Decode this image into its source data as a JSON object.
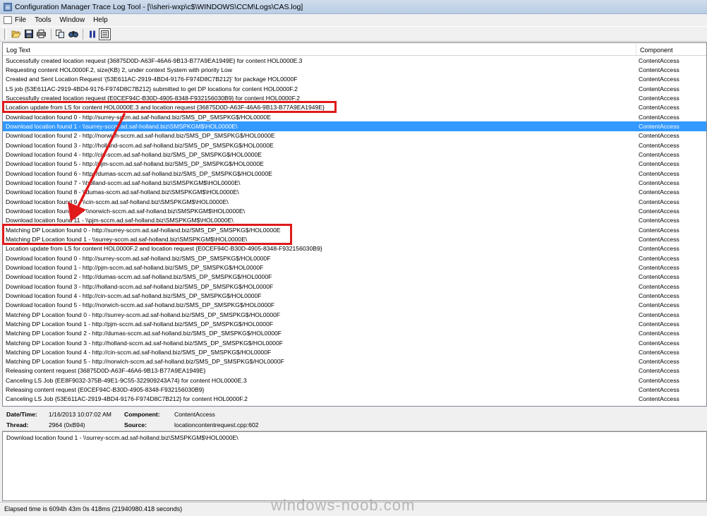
{
  "window": {
    "title": "Configuration Manager Trace Log Tool - [\\\\sheri-wxp\\c$\\WINDOWS\\CCM\\Logs\\CAS.log]"
  },
  "menu": [
    "File",
    "Tools",
    "Window",
    "Help"
  ],
  "toolbar": {
    "icons": [
      "open-icon",
      "save-icon",
      "print-icon",
      "copy-icon",
      "find-icon",
      "pause-icon",
      "highlight-icon"
    ]
  },
  "columns": {
    "log": "Log Text",
    "component": "Component"
  },
  "rows": [
    {
      "text": "Successfully created location request {36875D0D-A63F-46A6-9B13-B77A9EA1949E} for content HOL0000E.3",
      "component": "ContentAccess"
    },
    {
      "text": "Requesting content HOL0000F.2, size(KB) 2, under context System with priority Low",
      "component": "ContentAccess"
    },
    {
      "text": "Created and Sent Location Request '{53E611AC-2919-4BD4-9176-F974D8C7B212}' for package HOL0000F",
      "component": "ContentAccess"
    },
    {
      "text": "LS job {53E611AC-2919-4BD4-9176-F974D8C7B212} submitted to get DP locations for content HOL0000F.2",
      "component": "ContentAccess"
    },
    {
      "text": "Successfully created location request {E0CEF94C-B30D-4905-8348-F932156030B9} for content HOL0000F.2",
      "component": "ContentAccess"
    },
    {
      "text": "Location update from LS for content HOL0000E.3 and location request {36875D0D-A63F-46A6-9B13-B77A9EA1949E}",
      "component": "ContentAccess"
    },
    {
      "text": "Download location found 0 - http://surrey-sccm.ad.saf-holland.biz/SMS_DP_SMSPKG$/HOL0000E",
      "component": "ContentAccess"
    },
    {
      "text": "Download location found 1 - \\\\surrey-sccm.ad.saf-holland.biz\\SMSPKGM$\\HOL0000E\\",
      "component": "ContentAccess"
    },
    {
      "text": "Download location found 2 - http://norwich-sccm.ad.saf-holland.biz/SMS_DP_SMSPKG$/HOL0000E",
      "component": "ContentAccess"
    },
    {
      "text": "Download location found 3 - http://holland-sccm.ad.saf-holland.biz/SMS_DP_SMSPKG$/HOL0000E",
      "component": "ContentAccess"
    },
    {
      "text": "Download location found 4 - http://cin-sccm.ad.saf-holland.biz/SMS_DP_SMSPKG$/HOL0000E",
      "component": "ContentAccess"
    },
    {
      "text": "Download location found 5 - http://pjm-sccm.ad.saf-holland.biz/SMS_DP_SMSPKG$/HOL0000E",
      "component": "ContentAccess"
    },
    {
      "text": "Download location found 6 - http://dumas-sccm.ad.saf-holland.biz/SMS_DP_SMSPKG$/HOL0000E",
      "component": "ContentAccess"
    },
    {
      "text": "Download location found 7 - \\\\holland-sccm.ad.saf-holland.biz\\SMSPKGM$\\HOL0000E\\",
      "component": "ContentAccess"
    },
    {
      "text": "Download location found 8 - \\\\dumas-sccm.ad.saf-holland.biz\\SMSPKGM$\\HOL0000E\\",
      "component": "ContentAccess"
    },
    {
      "text": "Download location found 9 - \\\\cin-sccm.ad.saf-holland.biz\\SMSPKGM$\\HOL0000E\\",
      "component": "ContentAccess"
    },
    {
      "text": "Download location found 10 - \\\\norwich-sccm.ad.saf-holland.biz\\SMSPKGM$\\HOL0000E\\",
      "component": "ContentAccess"
    },
    {
      "text": "Download location found 11 - \\\\pjm-sccm.ad.saf-holland.biz\\SMSPKGM$\\HOL0000E\\",
      "component": "ContentAccess"
    },
    {
      "text": "Matching DP Location found 0 - http://surrey-sccm.ad.saf-holland.biz/SMS_DP_SMSPKG$/HOL0000E",
      "component": "ContentAccess"
    },
    {
      "text": "Matching DP Location found 1 - \\\\surrey-sccm.ad.saf-holland.biz\\SMSPKGM$\\HOL0000E\\",
      "component": "ContentAccess"
    },
    {
      "text": "Location update from LS for content HOL0000F.2 and location request {E0CEF94C-B30D-4905-8348-F932156030B9}",
      "component": "ContentAccess"
    },
    {
      "text": "Download location found 0 - http://surrey-sccm.ad.saf-holland.biz/SMS_DP_SMSPKG$/HOL0000F",
      "component": "ContentAccess"
    },
    {
      "text": "Download location found 1 - http://pjm-sccm.ad.saf-holland.biz/SMS_DP_SMSPKG$/HOL0000F",
      "component": "ContentAccess"
    },
    {
      "text": "Download location found 2 - http://dumas-sccm.ad.saf-holland.biz/SMS_DP_SMSPKG$/HOL0000F",
      "component": "ContentAccess"
    },
    {
      "text": "Download location found 3 - http://holland-sccm.ad.saf-holland.biz/SMS_DP_SMSPKG$/HOL0000F",
      "component": "ContentAccess"
    },
    {
      "text": "Download location found 4 - http://cin-sccm.ad.saf-holland.biz/SMS_DP_SMSPKG$/HOL0000F",
      "component": "ContentAccess"
    },
    {
      "text": "Download location found 5 - http://norwich-sccm.ad.saf-holland.biz/SMS_DP_SMSPKG$/HOL0000F",
      "component": "ContentAccess"
    },
    {
      "text": "Matching DP Location found 0 - http://surrey-sccm.ad.saf-holland.biz/SMS_DP_SMSPKG$/HOL0000F",
      "component": "ContentAccess"
    },
    {
      "text": "Matching DP Location found 1 - http://pjm-sccm.ad.saf-holland.biz/SMS_DP_SMSPKG$/HOL0000F",
      "component": "ContentAccess"
    },
    {
      "text": "Matching DP Location found 2 - http://dumas-sccm.ad.saf-holland.biz/SMS_DP_SMSPKG$/HOL0000F",
      "component": "ContentAccess"
    },
    {
      "text": "Matching DP Location found 3 - http://holland-sccm.ad.saf-holland.biz/SMS_DP_SMSPKG$/HOL0000F",
      "component": "ContentAccess"
    },
    {
      "text": "Matching DP Location found 4 - http://cin-sccm.ad.saf-holland.biz/SMS_DP_SMSPKG$/HOL0000F",
      "component": "ContentAccess"
    },
    {
      "text": "Matching DP Location found 5 - http://norwich-sccm.ad.saf-holland.biz/SMS_DP_SMSPKG$/HOL0000F",
      "component": "ContentAccess"
    },
    {
      "text": "Releasing content request {36875D0D-A63F-46A6-9B13-B77A9EA1949E}",
      "component": "ContentAccess"
    },
    {
      "text": "Canceling LS Job {EE8F9032-375B-49E1-9C55-322909243A74} for content HOL0000E.3",
      "component": "ContentAccess"
    },
    {
      "text": "Releasing content request {E0CEF94C-B30D-4905-8348-F932156030B9}",
      "component": "ContentAccess"
    },
    {
      "text": "Canceling LS Job {53E611AC-2919-4BD4-9176-F974D8C7B212} for content HOL0000F.2",
      "component": "ContentAccess"
    }
  ],
  "selected_row": 7,
  "details": {
    "datetime_label": "Date/Time:",
    "datetime_value": "1/16/2013 10:07:02 AM",
    "component_label": "Component:",
    "component_value": "ContentAccess",
    "thread_label": "Thread:",
    "thread_value": "2964 (0xB94)",
    "source_label": "Source:",
    "source_value": "locationcontentrequest.cpp:602"
  },
  "message": "Download location found 1 - \\\\surrey-sccm.ad.saf-holland.biz\\SMSPKGM$\\HOL0000E\\",
  "status": "Elapsed time is 6094h 43m 0s 418ms (21940980.418 seconds)",
  "watermark": "windows-noob.com",
  "annotation_color": "#e01a1a"
}
